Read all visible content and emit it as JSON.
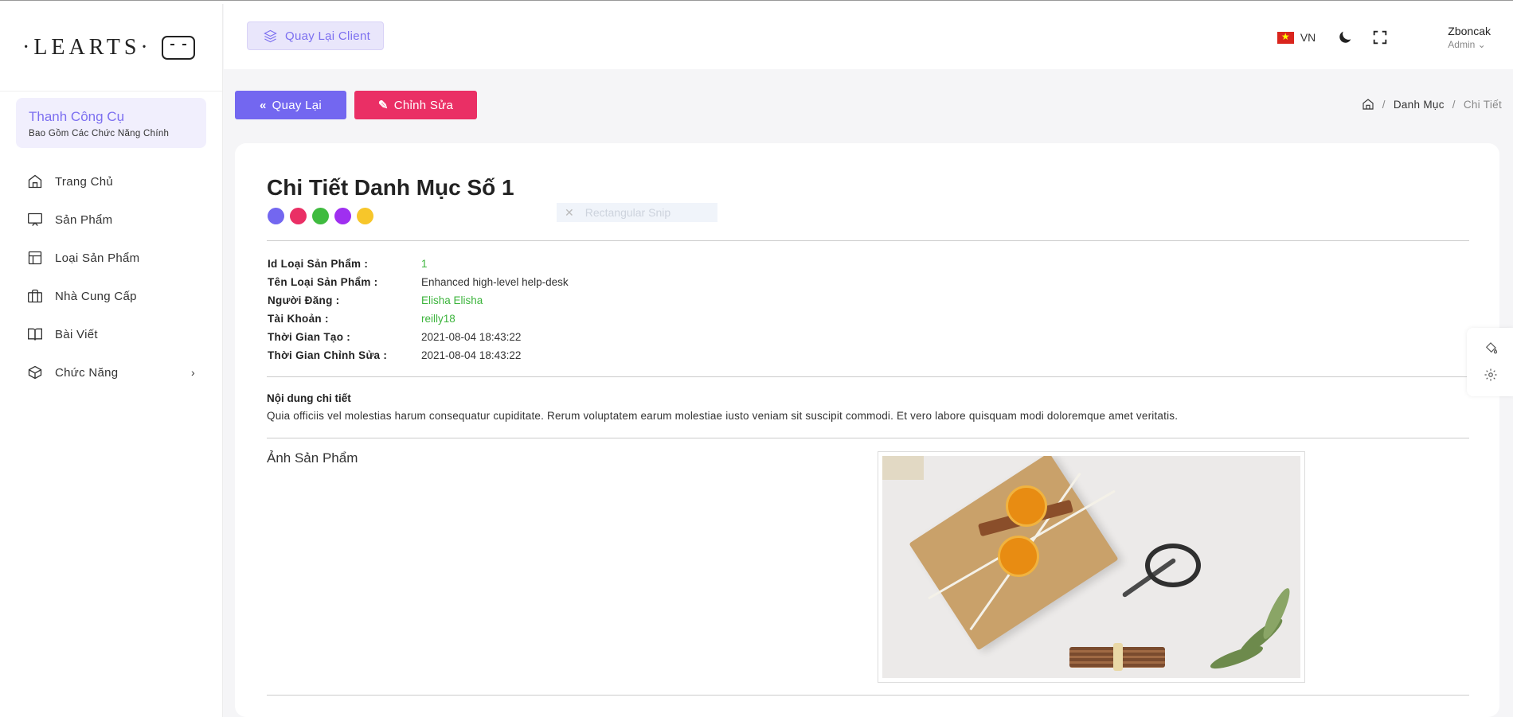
{
  "brand": {
    "logo_text": "·LEARTS·"
  },
  "sidebar": {
    "tools_title": "Thanh Công Cụ",
    "tools_subtitle": "Bao Gồm Các Chức Năng Chính",
    "items": [
      {
        "label": "Trang Chủ",
        "icon": "home-icon"
      },
      {
        "label": "Sản Phẩm",
        "icon": "monitor-icon"
      },
      {
        "label": "Loại Sản Phẩm",
        "icon": "layout-icon"
      },
      {
        "label": "Nhà Cung Cấp",
        "icon": "briefcase-icon"
      },
      {
        "label": "Bài Viết",
        "icon": "book-icon"
      },
      {
        "label": "Chức Năng",
        "icon": "box-icon",
        "chevron": "›"
      }
    ]
  },
  "header": {
    "back_client": "Quay Lại Client",
    "language": "VN",
    "user_name": "Zboncak",
    "user_role": "Admin ⌄"
  },
  "actions": {
    "back": "Quay Lại",
    "edit": "Chỉnh Sửa"
  },
  "breadcrumb": {
    "parent": "Danh Mục",
    "current": "Chi Tiết",
    "sep": "/"
  },
  "detail": {
    "title": "Chi Tiết Danh Mục Số 1",
    "color_dots": [
      "#7367f0",
      "#ea2f65",
      "#3fbb3f",
      "#9f2ff0",
      "#f7c62a"
    ],
    "snip_label": "Rectangular Snip",
    "fields": [
      {
        "label": "Id Loại Sản Phẩm    :",
        "value": "1",
        "accent": true
      },
      {
        "label": "Tên Loại Sản Phẩm    :",
        "value": "Enhanced high-level help-desk",
        "accent": false
      },
      {
        "label": "Người Đăng    :",
        "value": "Elisha Elisha",
        "accent": true
      },
      {
        "label": "Tài Khoản    :",
        "value": "reilly18",
        "accent": true
      },
      {
        "label": "Thời Gian Tạo    :",
        "value": "2021-08-04 18:43:22",
        "accent": false
      },
      {
        "label": "Thời Gian Chỉnh Sửa    :",
        "value": "2021-08-04 18:43:22",
        "accent": false
      }
    ],
    "content_heading": "Nội dung chi tiết",
    "content_text": "Quia officiis vel molestias harum consequatur cupiditate. Rerum voluptatem earum molestiae iusto veniam sit suscipit commodi. Et vero labore quisquam modi doloremque amet veritatis.",
    "image_heading": "Ảnh Sản Phẩm"
  },
  "colors": {
    "primary": "#7367f0",
    "danger": "#ea2f65",
    "success": "#3cb43c"
  }
}
